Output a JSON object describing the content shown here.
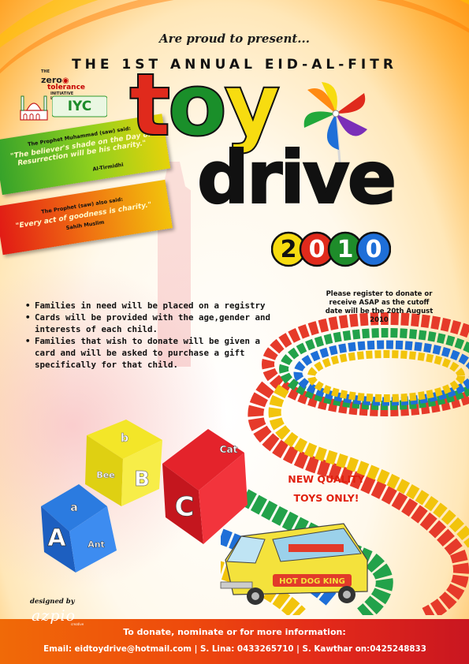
{
  "header": {
    "present": "Are proud to present...",
    "title": "THE 1ST ANNUAL EID-AL-FITR"
  },
  "logos": {
    "zero_prefix": "THE",
    "zero_word": "zero",
    "zero_tolerance": "tolerance",
    "zero_sub": "INITIATIVE LIMITED",
    "iyc": "IYC",
    "designer_label": "designed by",
    "designer_name": "azpio",
    "designer_sub": "creative"
  },
  "headline": {
    "toy_letters": [
      "t",
      "o",
      "y"
    ],
    "drive": "drive",
    "year_digits": [
      "2",
      "0",
      "1",
      "0"
    ]
  },
  "quotes": [
    {
      "lead": "The Prophet Muhammad (saw) said:",
      "text": "\"The believer's shade on the Day of Resurrection will be his charity.\"",
      "source": "Al-Tirmidhi"
    },
    {
      "lead": "The Prophet (saw) also said:",
      "text": "\"Every act of goodness is charity.\"",
      "source": "Sahih Muslim"
    }
  ],
  "register_note": "Please register to donate or receive ASAP as the cutoff date will be the 20th August 2010",
  "bullets": [
    "Families in need will be placed on a registry",
    "Cards will be provided with the age,gender and interests of each child.",
    "Families that wish to donate will be given a card and will be asked to purchase a gift specifically for that child."
  ],
  "new_quality": {
    "line1": "NEW QUALITY",
    "line2": "TOYS ONLY!"
  },
  "blocks_letters": {
    "b_top": "b",
    "bee": "Bee",
    "big_b": "B",
    "a_top": "a",
    "ant": "Ant",
    "big_a": "A",
    "cat": "Cat",
    "big_c": "C"
  },
  "truck_sign": "HOT DOG KING",
  "footer": {
    "line1": "To donate, nominate or for more information:",
    "line2": "Email: eidtoydrive@hotmail.com | S. Lina: 0433265710 | S. Kawthar on:0425248833"
  },
  "colors": {
    "orange": "#ff9a16",
    "toy_t": "#e02a1c",
    "toy_o": "#1a8f2a",
    "toy_y": "#f7dc10",
    "footer_red": "#c91620",
    "accent_red": "#e0200e"
  }
}
